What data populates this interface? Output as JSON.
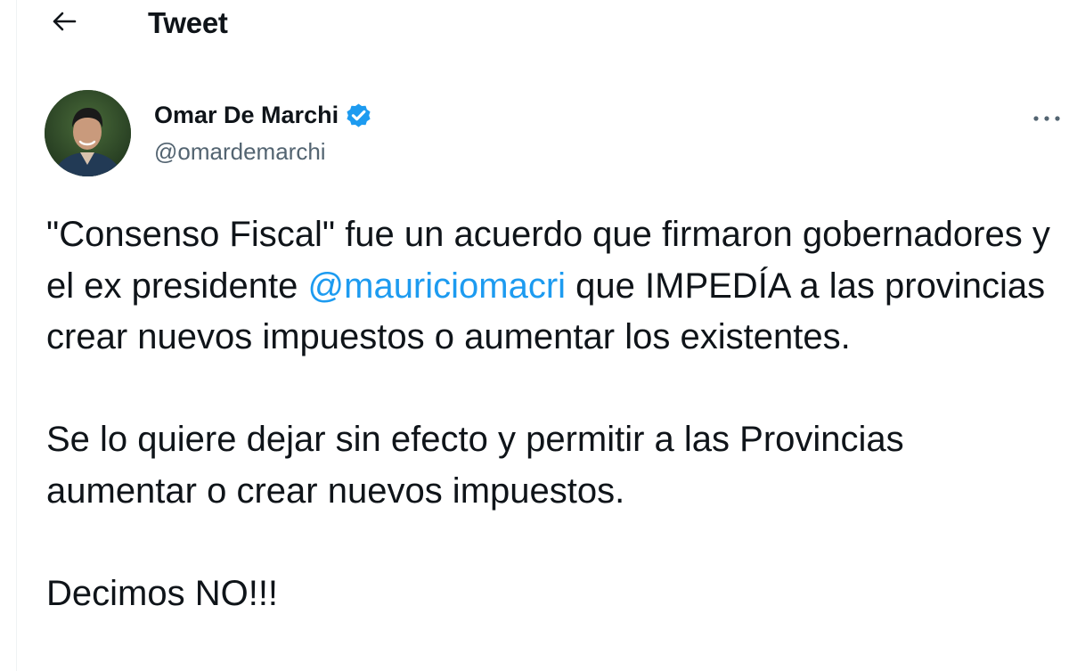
{
  "header": {
    "title": "Tweet",
    "back_icon": "arrow-left-icon"
  },
  "author": {
    "display_name": "Omar De Marchi",
    "handle": "@omardemarchi",
    "verified_icon": "verified-badge-icon",
    "verified_color": "#1d9bf0"
  },
  "tweet": {
    "paragraph1": {
      "before_mention": "\"Consenso Fiscal\" fue un acuerdo que firmaron gobernadores y el ex presidente ",
      "mention": "@mauriciomacri",
      "after_mention": " que IMPEDÍA a las provincias crear nuevos impuestos o aumentar los existentes."
    },
    "paragraph2": "Se lo quiere dejar sin efecto y permitir a las Provincias aumentar o crear nuevos impuestos.",
    "paragraph3": "Decimos NO!!!"
  },
  "colors": {
    "text": "#0f1419",
    "secondary": "#536471",
    "link": "#1d9bf0"
  }
}
